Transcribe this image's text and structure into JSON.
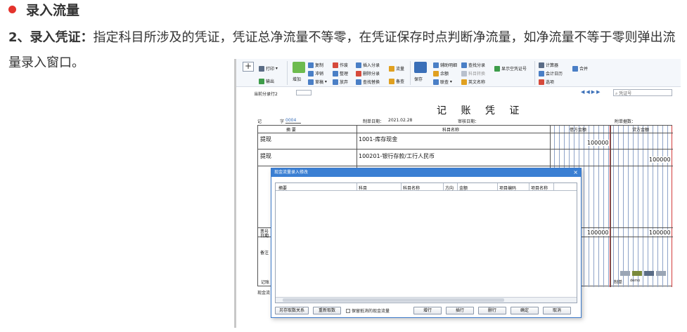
{
  "article": {
    "heading": "录入流量",
    "para_lead": "2、录入凭证：",
    "para_text": "指定科目所涉及的凭证，凭证总净流量不等零，在凭证保存时点判断净流量，如净流量不等于零则弹出流量录入窗口。"
  },
  "toolbar": {
    "plus": "+",
    "print": "打印",
    "output": "输出",
    "add": "增加",
    "copy": "复制",
    "reverse": "冲销",
    "draft": "草稿",
    "void": "作废",
    "tidy": "整理",
    "abandon": "放弃",
    "insert_entry": "插入分录",
    "delete_entry": "删除分录",
    "find_replace": "查找替换",
    "flow": "流量",
    "check": "备查",
    "save": "保存",
    "aux_detail": "辅助明细",
    "balance": "余额",
    "linked": "联查",
    "find_entry": "查找分录",
    "subject_convert": "科目转换",
    "en_name": "英文名称",
    "show_empty": "显示空凭证号",
    "calculator": "计算器",
    "calendar": "会计日历",
    "options": "选项",
    "merge": "合并"
  },
  "subbar": {
    "current_entry": "当前分录行2",
    "voucher_no_placeholder": "凭证号"
  },
  "voucher": {
    "title": "记 账 凭 证",
    "type_label": "记",
    "no_label": "字",
    "no_value": "0004",
    "date_label": "制单日期：",
    "date_value": "2021.02.28",
    "audit_label": "审核日期：",
    "attach_label": "附单据数：",
    "col_summary": "摘 要",
    "col_subject": "科目名称",
    "col_debit": "借方金额",
    "col_credit": "贷方金额",
    "rows": [
      {
        "summary": "提现",
        "subject": "1001-库存现金",
        "debit": "100000",
        "credit": ""
      },
      {
        "summary": "提现",
        "subject": "100201-银行存款/工行人民币",
        "debit": "",
        "credit": "100000"
      }
    ],
    "total_debit": "100000",
    "total_credit": "100000",
    "ticket_label": "票号",
    "ticket_date_label": "日期",
    "remark_label": "备注",
    "bookkeeper_label": "记账",
    "maker_label": "制单",
    "maker_value": "demo",
    "cash_label": "现金流"
  },
  "dialog": {
    "title": "现金流量录入修改",
    "close": "×",
    "columns": [
      "摘要",
      "科目",
      "科目名称",
      "方向",
      "金额",
      "项目编码",
      "项目名称"
    ],
    "btn_save_relation": "另存取数关系",
    "btn_refetch": "重新取数",
    "chk_keep": "保留抵消的现金流量",
    "btn_add_row": "增行",
    "btn_insert_row": "插行",
    "btn_delete_row": "删行",
    "btn_ok": "确定",
    "btn_cancel": "取消"
  }
}
